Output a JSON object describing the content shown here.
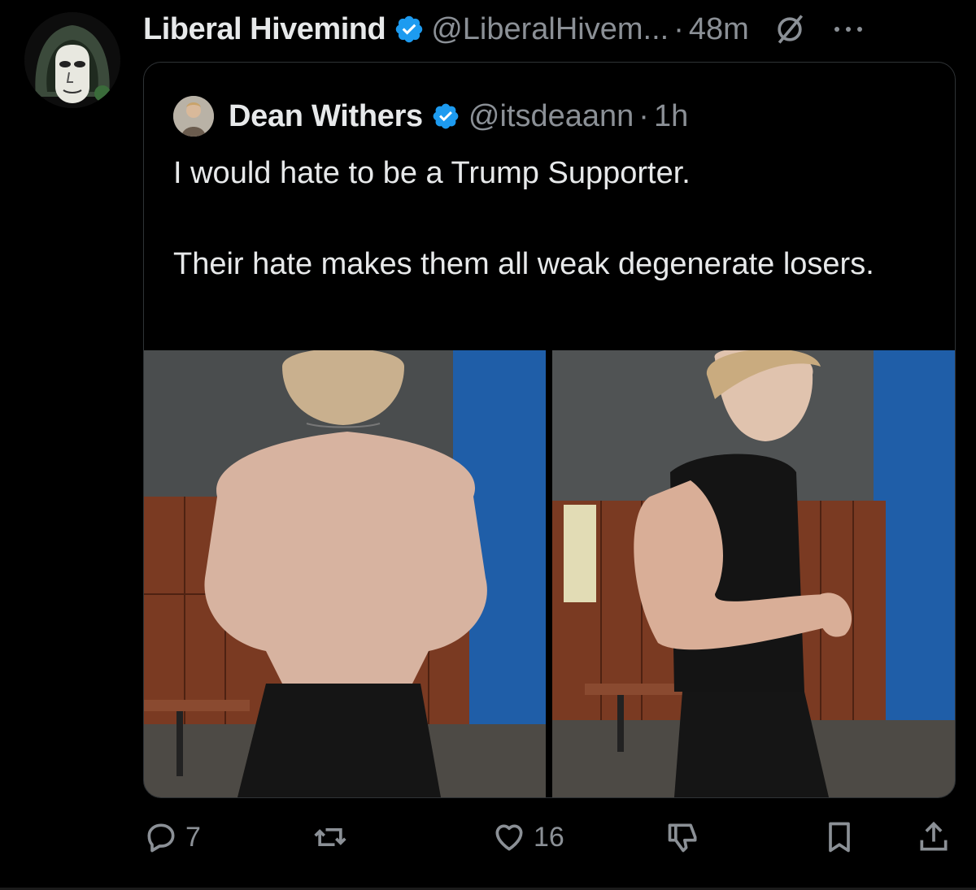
{
  "tweet": {
    "author_name": "Liberal Hivemind",
    "author_handle": "@LiberalHivem...",
    "separator": "·",
    "time": "48m",
    "avatar_icon": "hooded-wojak-avatar",
    "verified_icon": "verified-badge-icon",
    "grok_icon": "grok-slash-icon",
    "more_icon": "more-dots-icon"
  },
  "quote": {
    "author_name": "Dean Withers",
    "author_handle": "@itsdeaann",
    "separator": "·",
    "time": "1h",
    "text": "I would hate to be a Trump Supporter.\n\nTheir hate makes them all weak degenerate losers.",
    "images": [
      "back-pose-photo",
      "side-flex-photo"
    ]
  },
  "actions": {
    "reply_count": "7",
    "repost_count": "",
    "like_count": "16",
    "colors": {
      "icon": "#8b9096",
      "verified": "#1d9bf0"
    }
  }
}
